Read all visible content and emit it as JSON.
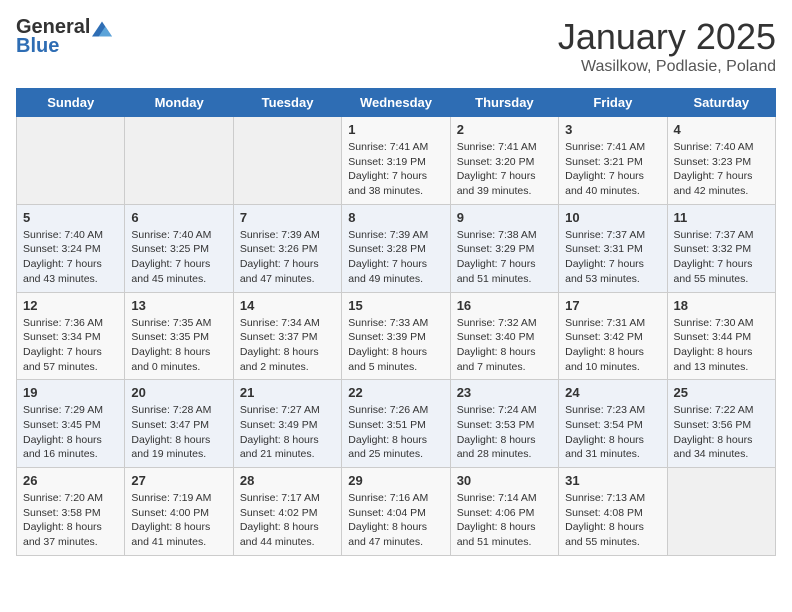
{
  "logo": {
    "general": "General",
    "blue": "Blue"
  },
  "title": "January 2025",
  "subtitle": "Wasilkow, Podlasie, Poland",
  "days_of_week": [
    "Sunday",
    "Monday",
    "Tuesday",
    "Wednesday",
    "Thursday",
    "Friday",
    "Saturday"
  ],
  "weeks": [
    [
      {
        "day": "",
        "info": ""
      },
      {
        "day": "",
        "info": ""
      },
      {
        "day": "",
        "info": ""
      },
      {
        "day": "1",
        "info": "Sunrise: 7:41 AM\nSunset: 3:19 PM\nDaylight: 7 hours\nand 38 minutes."
      },
      {
        "day": "2",
        "info": "Sunrise: 7:41 AM\nSunset: 3:20 PM\nDaylight: 7 hours\nand 39 minutes."
      },
      {
        "day": "3",
        "info": "Sunrise: 7:41 AM\nSunset: 3:21 PM\nDaylight: 7 hours\nand 40 minutes."
      },
      {
        "day": "4",
        "info": "Sunrise: 7:40 AM\nSunset: 3:23 PM\nDaylight: 7 hours\nand 42 minutes."
      }
    ],
    [
      {
        "day": "5",
        "info": "Sunrise: 7:40 AM\nSunset: 3:24 PM\nDaylight: 7 hours\nand 43 minutes."
      },
      {
        "day": "6",
        "info": "Sunrise: 7:40 AM\nSunset: 3:25 PM\nDaylight: 7 hours\nand 45 minutes."
      },
      {
        "day": "7",
        "info": "Sunrise: 7:39 AM\nSunset: 3:26 PM\nDaylight: 7 hours\nand 47 minutes."
      },
      {
        "day": "8",
        "info": "Sunrise: 7:39 AM\nSunset: 3:28 PM\nDaylight: 7 hours\nand 49 minutes."
      },
      {
        "day": "9",
        "info": "Sunrise: 7:38 AM\nSunset: 3:29 PM\nDaylight: 7 hours\nand 51 minutes."
      },
      {
        "day": "10",
        "info": "Sunrise: 7:37 AM\nSunset: 3:31 PM\nDaylight: 7 hours\nand 53 minutes."
      },
      {
        "day": "11",
        "info": "Sunrise: 7:37 AM\nSunset: 3:32 PM\nDaylight: 7 hours\nand 55 minutes."
      }
    ],
    [
      {
        "day": "12",
        "info": "Sunrise: 7:36 AM\nSunset: 3:34 PM\nDaylight: 7 hours\nand 57 minutes."
      },
      {
        "day": "13",
        "info": "Sunrise: 7:35 AM\nSunset: 3:35 PM\nDaylight: 8 hours\nand 0 minutes."
      },
      {
        "day": "14",
        "info": "Sunrise: 7:34 AM\nSunset: 3:37 PM\nDaylight: 8 hours\nand 2 minutes."
      },
      {
        "day": "15",
        "info": "Sunrise: 7:33 AM\nSunset: 3:39 PM\nDaylight: 8 hours\nand 5 minutes."
      },
      {
        "day": "16",
        "info": "Sunrise: 7:32 AM\nSunset: 3:40 PM\nDaylight: 8 hours\nand 7 minutes."
      },
      {
        "day": "17",
        "info": "Sunrise: 7:31 AM\nSunset: 3:42 PM\nDaylight: 8 hours\nand 10 minutes."
      },
      {
        "day": "18",
        "info": "Sunrise: 7:30 AM\nSunset: 3:44 PM\nDaylight: 8 hours\nand 13 minutes."
      }
    ],
    [
      {
        "day": "19",
        "info": "Sunrise: 7:29 AM\nSunset: 3:45 PM\nDaylight: 8 hours\nand 16 minutes."
      },
      {
        "day": "20",
        "info": "Sunrise: 7:28 AM\nSunset: 3:47 PM\nDaylight: 8 hours\nand 19 minutes."
      },
      {
        "day": "21",
        "info": "Sunrise: 7:27 AM\nSunset: 3:49 PM\nDaylight: 8 hours\nand 21 minutes."
      },
      {
        "day": "22",
        "info": "Sunrise: 7:26 AM\nSunset: 3:51 PM\nDaylight: 8 hours\nand 25 minutes."
      },
      {
        "day": "23",
        "info": "Sunrise: 7:24 AM\nSunset: 3:53 PM\nDaylight: 8 hours\nand 28 minutes."
      },
      {
        "day": "24",
        "info": "Sunrise: 7:23 AM\nSunset: 3:54 PM\nDaylight: 8 hours\nand 31 minutes."
      },
      {
        "day": "25",
        "info": "Sunrise: 7:22 AM\nSunset: 3:56 PM\nDaylight: 8 hours\nand 34 minutes."
      }
    ],
    [
      {
        "day": "26",
        "info": "Sunrise: 7:20 AM\nSunset: 3:58 PM\nDaylight: 8 hours\nand 37 minutes."
      },
      {
        "day": "27",
        "info": "Sunrise: 7:19 AM\nSunset: 4:00 PM\nDaylight: 8 hours\nand 41 minutes."
      },
      {
        "day": "28",
        "info": "Sunrise: 7:17 AM\nSunset: 4:02 PM\nDaylight: 8 hours\nand 44 minutes."
      },
      {
        "day": "29",
        "info": "Sunrise: 7:16 AM\nSunset: 4:04 PM\nDaylight: 8 hours\nand 47 minutes."
      },
      {
        "day": "30",
        "info": "Sunrise: 7:14 AM\nSunset: 4:06 PM\nDaylight: 8 hours\nand 51 minutes."
      },
      {
        "day": "31",
        "info": "Sunrise: 7:13 AM\nSunset: 4:08 PM\nDaylight: 8 hours\nand 55 minutes."
      },
      {
        "day": "",
        "info": ""
      }
    ]
  ]
}
